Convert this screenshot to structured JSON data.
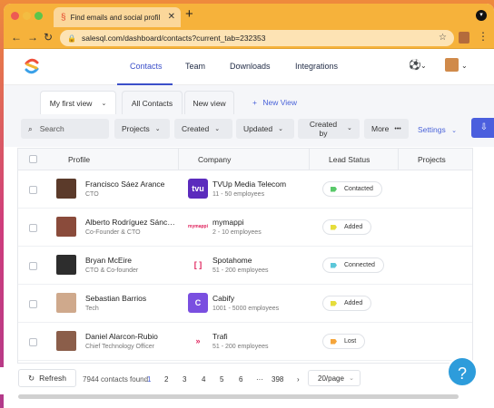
{
  "browser": {
    "tab_title": "Find emails and social profiles",
    "url": "salesql.com/dashboard/contacts?current_tab=232353"
  },
  "nav": {
    "items": [
      "Contacts",
      "Team",
      "Downloads",
      "Integrations"
    ],
    "active": "Contacts"
  },
  "views": {
    "tabs": [
      "My first view",
      "All Contacts",
      "New view"
    ],
    "new_view": "New View"
  },
  "filters": {
    "search_placeholder": "Search",
    "projects": "Projects",
    "created": "Created",
    "updated": "Updated",
    "created_by": "Created by",
    "more": "More",
    "settings": "Settings"
  },
  "table": {
    "headers": [
      "Profile",
      "Company",
      "Lead Status",
      "Projects"
    ],
    "rows": [
      {
        "name": "Francisco Sáez Arance",
        "title": "CTO",
        "company": "TVUp Media Telecom",
        "size": "11 - 50 employees",
        "status": "Contacted",
        "status_color": "#59c96a",
        "logo_color": "#5b2bbd",
        "logo_text": "tvu"
      },
      {
        "name": "Alberto Rodríguez Sánc…",
        "title": "Co-Founder & CTO",
        "company": "mymappi",
        "size": "2 - 10 employees",
        "status": "Added",
        "status_color": "#e6dd3b",
        "logo_color": "#ffffff",
        "logo_text": "mymappi"
      },
      {
        "name": "Bryan McEire",
        "title": "CTO & Co-founder",
        "company": "Spotahome",
        "size": "51 - 200 employees",
        "status": "Connected",
        "status_color": "#5bc7d9",
        "logo_color": "#ffffff",
        "logo_text": "[ ]"
      },
      {
        "name": "Sebastian Barrios",
        "title": "Tech",
        "company": "Cabify",
        "size": "1001 - 5000 employees",
        "status": "Added",
        "status_color": "#e6dd3b",
        "logo_color": "#7a4fe0",
        "logo_text": "C"
      },
      {
        "name": "Daniel Alarcon-Rubio",
        "title": "Chief Technology Officer",
        "company": "Trafi",
        "size": "51 - 200 employees",
        "status": "Lost",
        "status_color": "#f5a53b",
        "logo_color": "#ffffff",
        "logo_text": "»"
      }
    ]
  },
  "footer": {
    "refresh": "Refresh",
    "count": "7944 contacts found",
    "pages": [
      "1",
      "2",
      "3",
      "4",
      "5",
      "6",
      "···",
      "398"
    ],
    "per_page": "20/page"
  }
}
